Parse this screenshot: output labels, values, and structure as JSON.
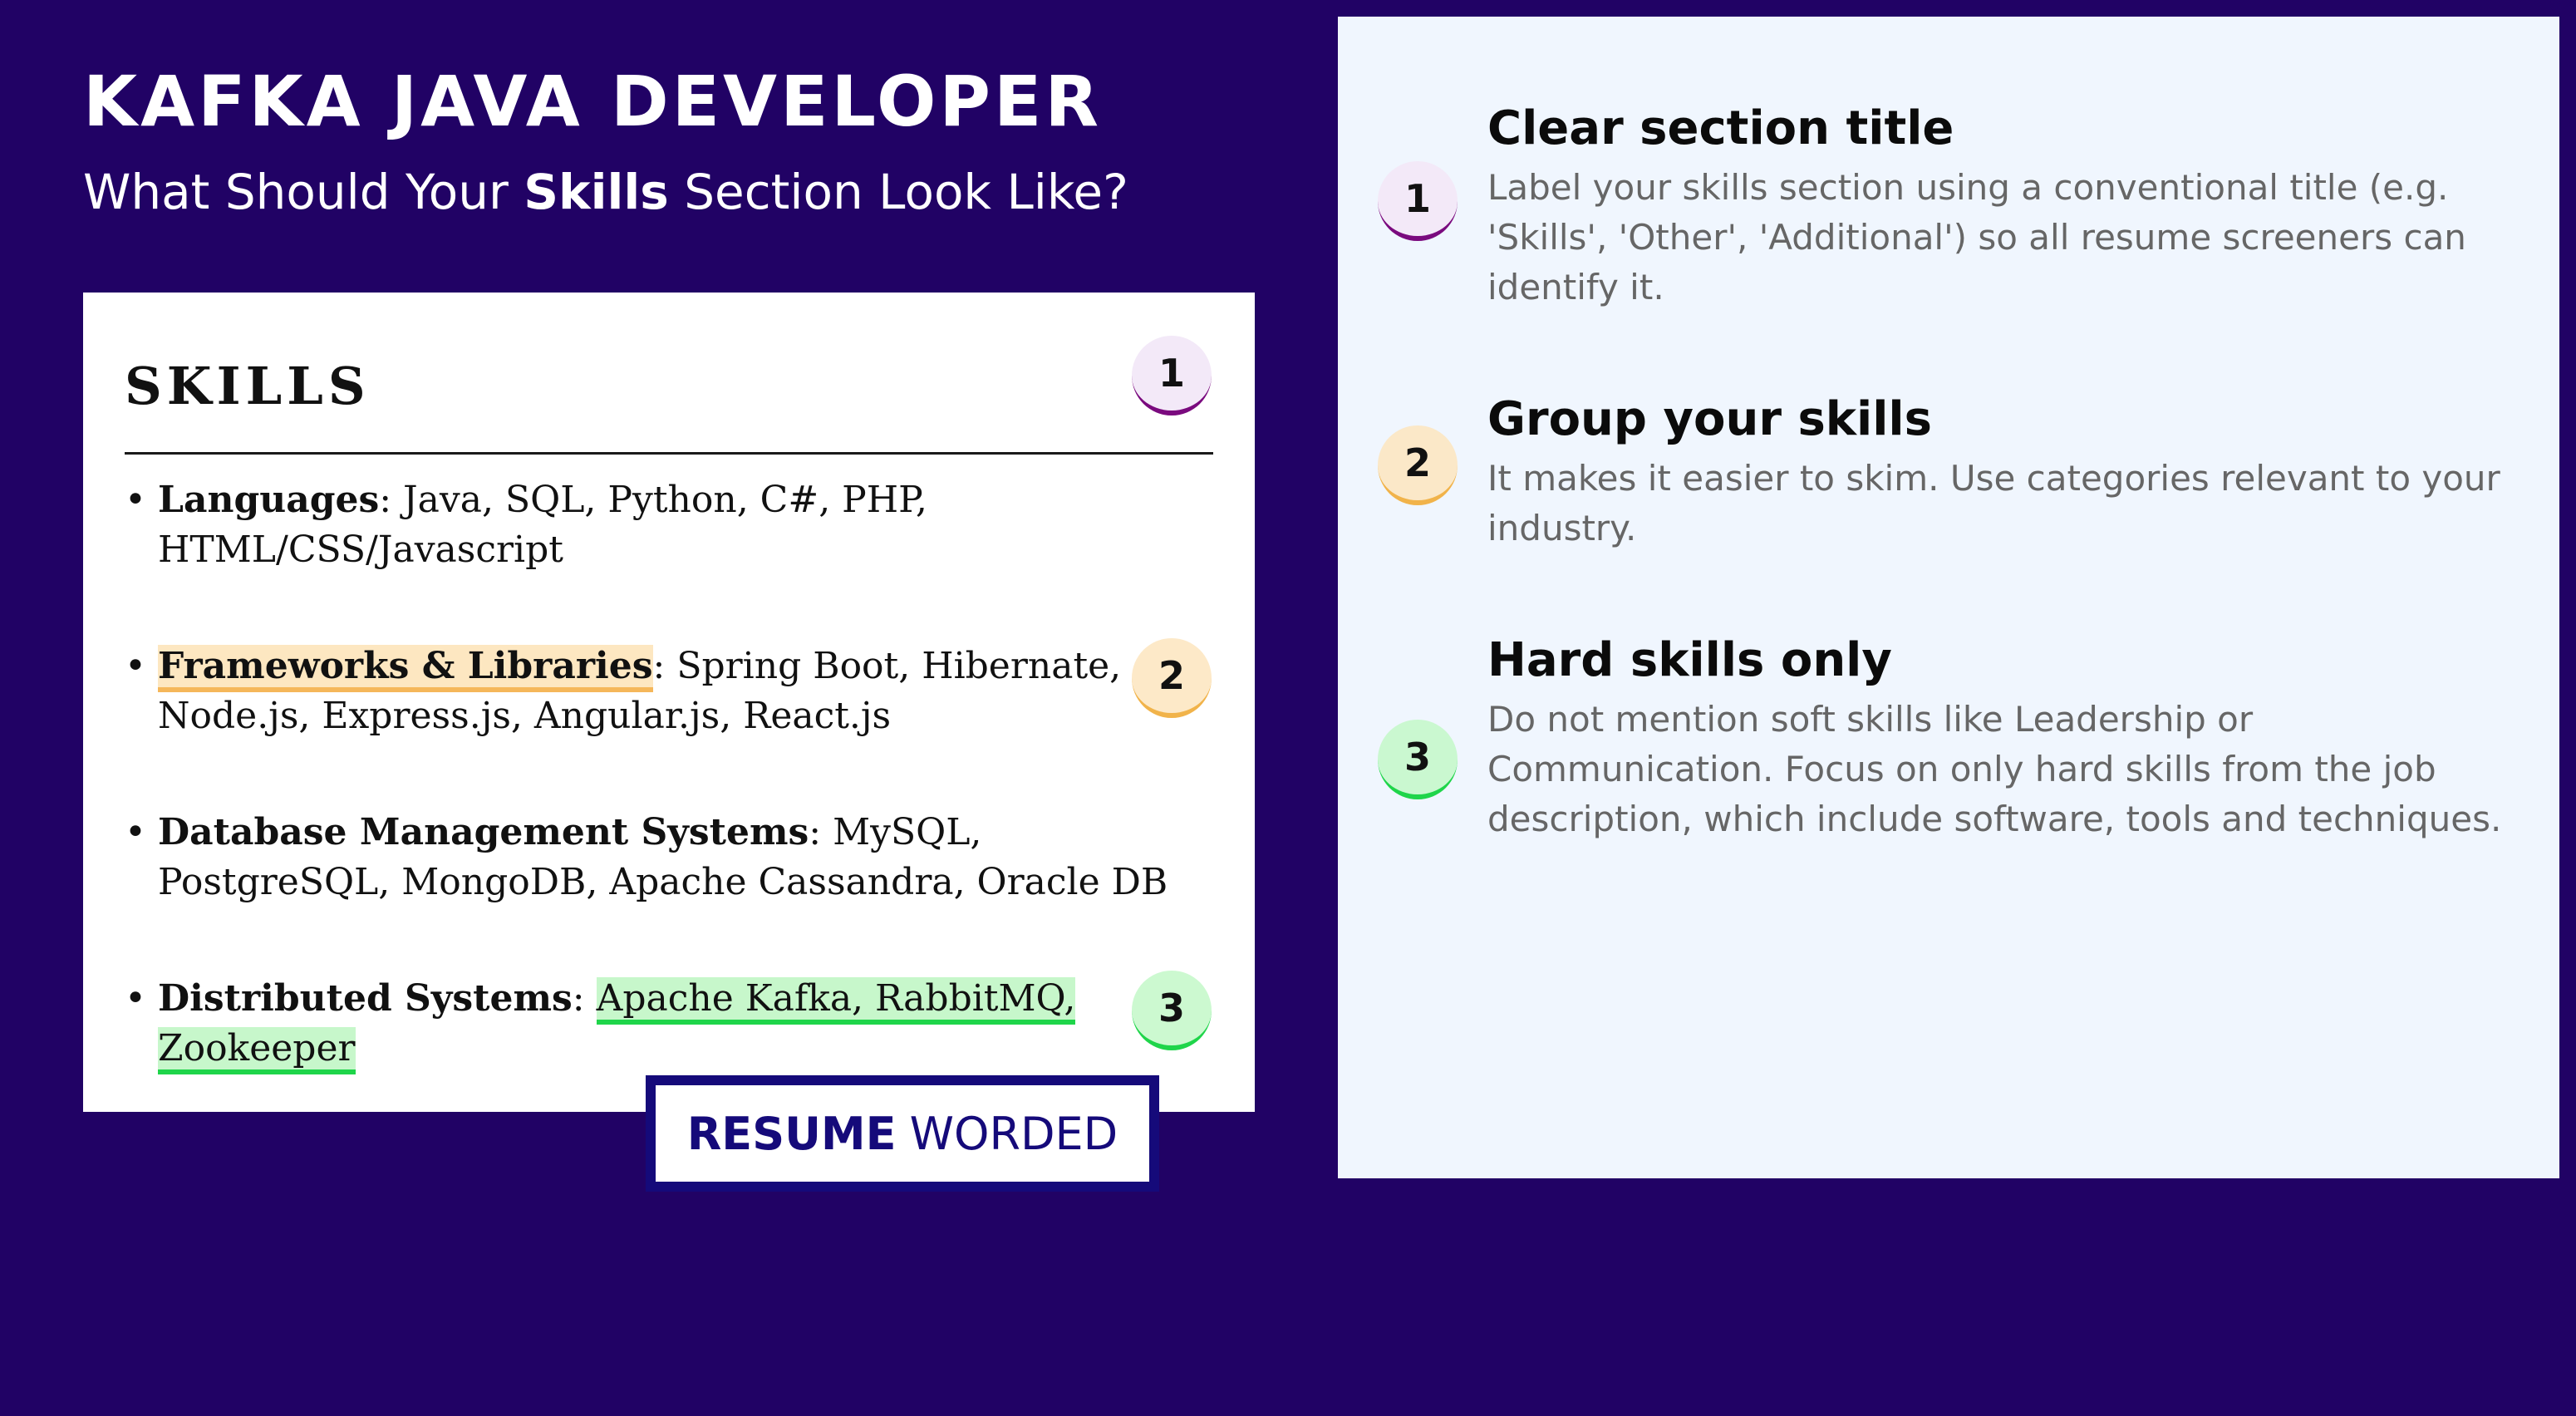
{
  "header": {
    "title": "KAFKA JAVA DEVELOPER",
    "subtitle_pre": "What Should Your ",
    "subtitle_bold": "Skills",
    "subtitle_post": " Section Look Like?"
  },
  "resume": {
    "heading": "SKILLS",
    "items": [
      {
        "label": "Languages",
        "text": ": Java, SQL, Python, C#, PHP, HTML/CSS/Javascript"
      },
      {
        "label": "Frameworks & Libraries",
        "text": ": Spring Boot, Hibernate, Node.js, Express.js, Angular.js, React.js"
      },
      {
        "label": "Database Management Systems",
        "text": ": MySQL, PostgreSQL, MongoDB, Apache Cassandra, Oracle DB"
      },
      {
        "label": "Distributed Systems",
        "text_pre": ": ",
        "text_hl": "Apache Kafka, RabbitMQ, Zookeeper"
      }
    ],
    "badges": [
      "1",
      "2",
      "3"
    ]
  },
  "logo": {
    "strong": "RESUME",
    "light": "WORDED"
  },
  "tips": [
    {
      "number": "1",
      "title": "Clear section title",
      "text": "Label your skills section using a conventional title (e.g. 'Skills', 'Other', 'Additional') so all resume screeners can identify it."
    },
    {
      "number": "2",
      "title": "Group your skills",
      "text": "It makes it easier to skim. Use categories relevant to your industry."
    },
    {
      "number": "3",
      "title": "Hard skills only",
      "text": "Do not mention soft skills like Leadership or Communication. Focus on only hard skills from the job description, which include software, tools and techniques."
    }
  ],
  "colors": {
    "background": "#210265",
    "panel": "#f0f6fe",
    "badge1_accent": "#7a0a7e",
    "badge2_accent": "#f1b34a",
    "badge3_accent": "#1fd54a",
    "logo": "#150a7a"
  }
}
